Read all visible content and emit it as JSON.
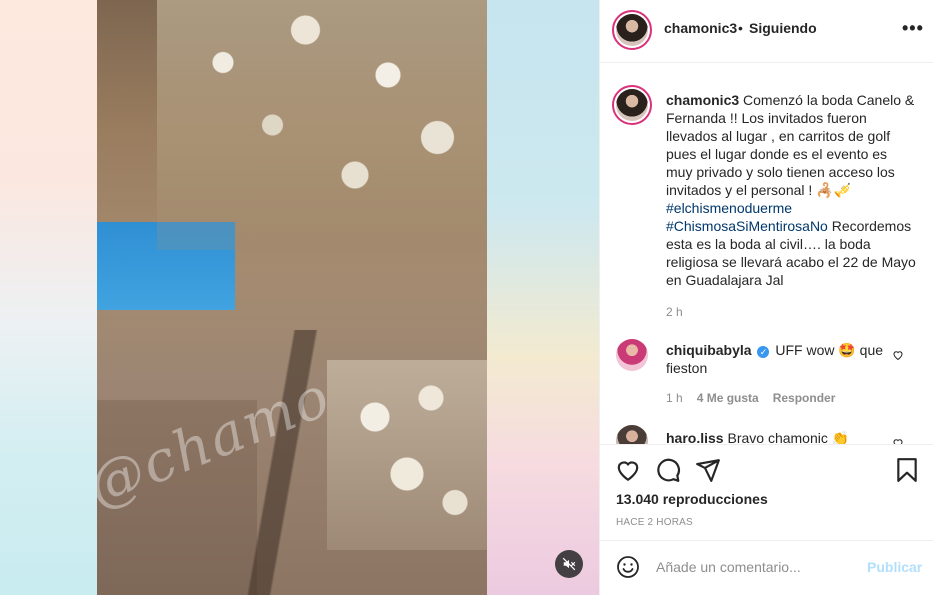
{
  "media": {
    "watermark": "@chamo",
    "mute_icon": "speaker-muted-icon"
  },
  "header": {
    "username": "chamonic3",
    "separator": "•",
    "follow_status": "Siguiendo",
    "more_icon": "more-options-icon",
    "more_label": "•••"
  },
  "caption": {
    "username": "chamonic3",
    "text_1": "Comenzó la boda Canelo & Fernanda !! Los invitados fueron llevados al lugar , en carritos de golf pues el lugar donde es el evento es muy privado y solo tienen acceso los invitados y el personal ! ",
    "emojis": "🦂🎺",
    "hashtag_1": "#elchismenoduerme",
    "hashtag_2": "#ChismosaSiMentirosaNo",
    "text_2": "Recordemos esta es la boda al civil…. la boda religiosa se llevará acabo el 22 de Mayo en Guadalajara Jal",
    "time": "2 h"
  },
  "comments": [
    {
      "username": "chiquibabyla",
      "verified_label": "✓",
      "text": "UFF wow 🤩 que fieston",
      "time": "1 h",
      "likes": "4 Me gusta",
      "reply": "Responder"
    },
    {
      "username": "haro.liss",
      "text": "Bravo chamonic 👏"
    }
  ],
  "actions": {
    "like_icon": "heart-icon",
    "comment_icon": "comment-icon",
    "share_icon": "share-icon",
    "save_icon": "bookmark-icon",
    "views": "13.040 reproducciones",
    "posted_ago": "Hace 2 horas"
  },
  "add_comment": {
    "emoji_icon": "smiley-icon",
    "placeholder": "Añade un comentario...",
    "post_label": "Publicar"
  },
  "colors": {
    "story_ring": "#d9317a",
    "link": "#00376b",
    "publish_disabled": "#b2dffc",
    "verified": "#3897f0"
  }
}
